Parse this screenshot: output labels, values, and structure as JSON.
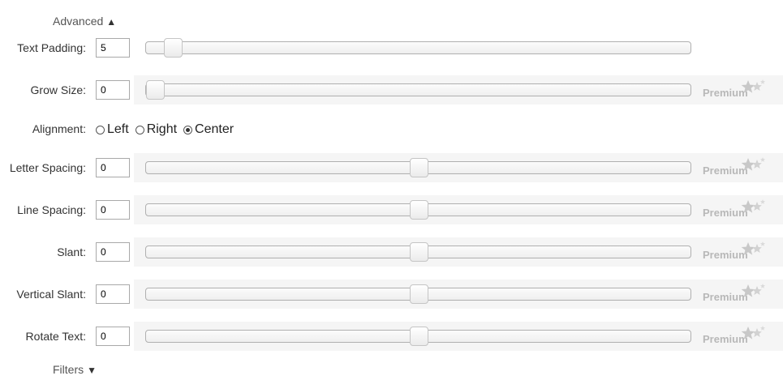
{
  "advanced_toggle": {
    "label": "Advanced",
    "arrow": "▲"
  },
  "filters_toggle": {
    "label": "Filters",
    "arrow": "▼"
  },
  "premium_label": "Premium",
  "controls": [
    {
      "id": "text-padding",
      "label": "Text Padding:",
      "value": "5",
      "slider_position": 0.05,
      "premium": false
    },
    {
      "id": "grow-size",
      "label": "Grow Size:",
      "value": "0",
      "slider_position": 0.0,
      "premium": true
    },
    {
      "id": "letter-spacing",
      "label": "Letter Spacing:",
      "value": "0",
      "slider_position": 0.5,
      "premium": true
    },
    {
      "id": "line-spacing",
      "label": "Line Spacing:",
      "value": "0",
      "slider_position": 0.5,
      "premium": true
    },
    {
      "id": "slant",
      "label": "Slant:",
      "value": "0",
      "slider_position": 0.5,
      "premium": true
    },
    {
      "id": "vertical-slant",
      "label": "Vertical Slant:",
      "value": "0",
      "slider_position": 0.5,
      "premium": true
    },
    {
      "id": "rotate-text",
      "label": "Rotate Text:",
      "value": "0",
      "slider_position": 0.5,
      "premium": true
    }
  ],
  "alignment": {
    "label": "Alignment:",
    "options": [
      "Left",
      "Right",
      "Center"
    ],
    "selected": "Center"
  },
  "colors": {
    "premium_text": "#b8b8b8",
    "row_background": "#f5f5f5"
  },
  "icons": {
    "premium": "stars-icon"
  }
}
